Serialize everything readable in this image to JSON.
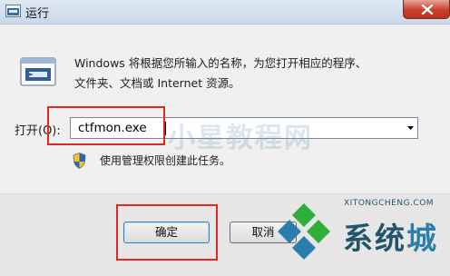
{
  "window": {
    "title": "运行",
    "close_icon": "close-icon"
  },
  "description": {
    "line1": "Windows 将根据您所输入的名称，为您打开相应的程序、",
    "line2": "文件夹、文档或 Internet 资源。"
  },
  "open_field": {
    "label": "打开(O):",
    "value": "ctfmon.exe"
  },
  "admin_note": "使用管理权限创建此任务。",
  "buttons": {
    "ok": "确定",
    "cancel": "取消"
  },
  "watermarks": {
    "center_text": "小星教程网",
    "logo_url": "XITONGCHENG.COM",
    "logo_char_1": "系",
    "logo_char_2": "统",
    "logo_char_3": "城"
  },
  "colors": {
    "highlight": "#e3261f",
    "titlebar": "#c9d8ea",
    "logo_green": "#2fae3c",
    "logo_blue": "#2a7ea9"
  }
}
